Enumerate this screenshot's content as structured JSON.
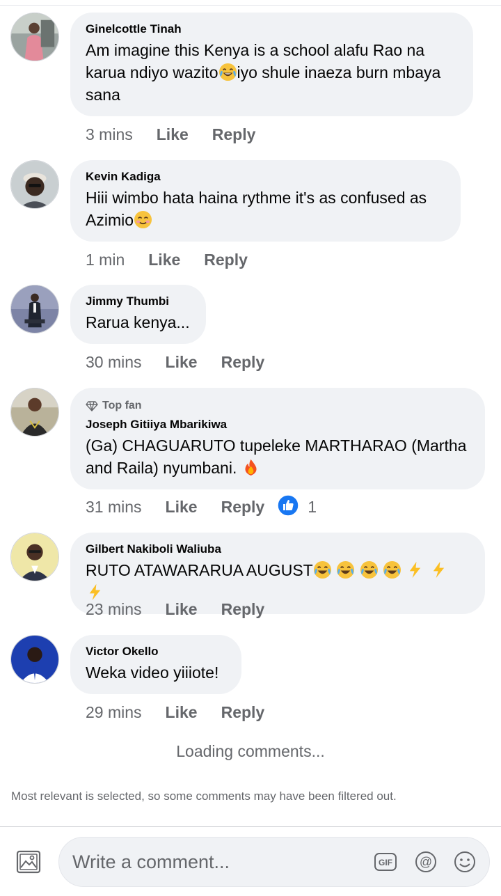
{
  "comments": [
    {
      "author": "Ginelcottle Tinah",
      "text_lines": [
        "Am imagine this Kenya is a school alafu Rao na",
        "karua ndiyo wazito",
        "iyo shule inaeza burn mbaya",
        "sana"
      ],
      "emoji": "face-with-tears-of-joy",
      "time": "3 mins",
      "like": "Like",
      "reply": "Reply"
    },
    {
      "author": "Kevin Kadiga",
      "text_lines": [
        "Hiii wimbo hata haina rythme it's as confused as",
        "Azimio"
      ],
      "emoji": "smiling-face",
      "time": "1 min",
      "like": "Like",
      "reply": "Reply"
    },
    {
      "author": "Jimmy Thumbi",
      "text": "Rarua kenya...",
      "time": "30 mins",
      "like": "Like",
      "reply": "Reply"
    },
    {
      "badge": "Top fan",
      "author": "Joseph Gitiiya Mbarikiwa",
      "text_lines": [
        "(Ga) CHAGUARUTO tupeleke MARTHARAO (Martha",
        "and Raila) nyumbani."
      ],
      "emoji": "fire",
      "time": "31 mins",
      "like": "Like",
      "reply": "Reply",
      "reaction_count": "1"
    },
    {
      "author": "Gilbert Nakiboli Waliuba",
      "text": "RUTO ATAWARARUA AUGUST",
      "emojis": [
        "face-with-tears-of-joy",
        "face-with-tears-of-joy",
        "face-with-tears-of-joy",
        "face-with-tears-of-joy",
        "high-voltage",
        "high-voltage",
        "high-voltage"
      ],
      "time": "23 mins",
      "like": "Like",
      "reply": "Reply"
    },
    {
      "author": "Victor Okello",
      "text": "Weka video yiiiote!",
      "time": "29 mins",
      "like": "Like",
      "reply": "Reply"
    }
  ],
  "loading_text": "Loading comments...",
  "filter_note": "Most relevant is selected, so some comments may have been filtered out.",
  "composer": {
    "placeholder": "Write a comment...",
    "gif_label": "GIF",
    "mention_label": "@"
  },
  "colors": {
    "bubble": "#f0f2f5",
    "secondary_text": "#65676b",
    "like_blue": "#1877f2"
  }
}
